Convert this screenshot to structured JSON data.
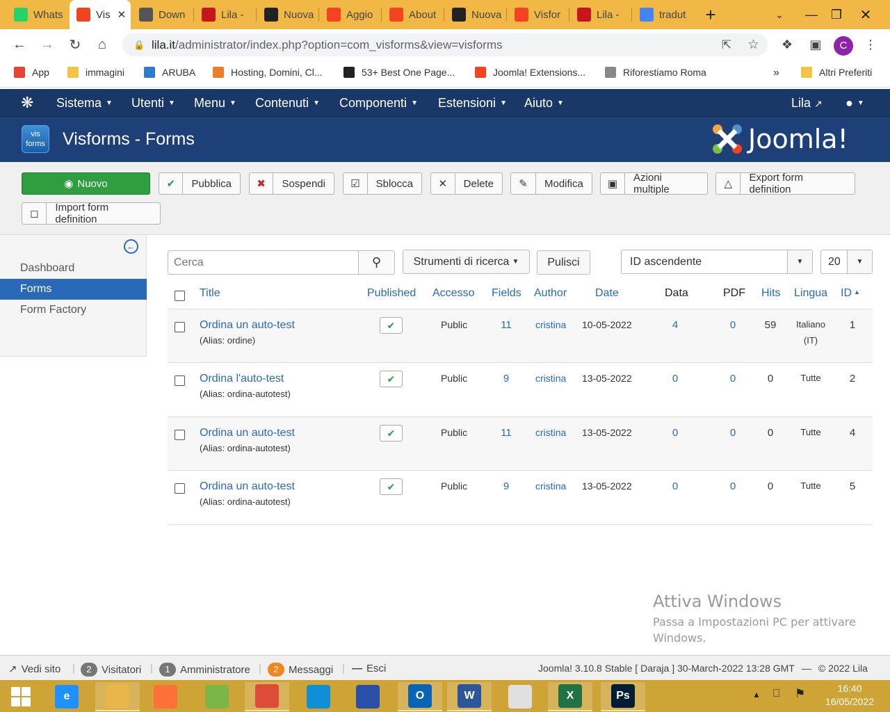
{
  "browser": {
    "tabs": [
      {
        "title": "Whats",
        "icon": "whatsapp-icon",
        "color": "#25d366"
      },
      {
        "title": "Vis",
        "icon": "joomla-icon",
        "color": "#f44321",
        "active": true
      },
      {
        "title": "Down",
        "icon": "download-icon",
        "color": "#555555"
      },
      {
        "title": "Lila -",
        "icon": "lila-icon",
        "color": "#c4161c"
      },
      {
        "title": "Nuova",
        "icon": "github-icon",
        "color": "#222222"
      },
      {
        "title": "Aggio",
        "icon": "joomla-icon",
        "color": "#f44321"
      },
      {
        "title": "About",
        "icon": "joomla-icon",
        "color": "#f44321"
      },
      {
        "title": "Nuova",
        "icon": "github-icon",
        "color": "#222222"
      },
      {
        "title": "Visfor",
        "icon": "joomla-icon",
        "color": "#f44321"
      },
      {
        "title": "Lila -",
        "icon": "lila-icon",
        "color": "#c4161c"
      },
      {
        "title": "tradut",
        "icon": "google-icon",
        "color": "#4285f4"
      }
    ],
    "url_host": "lila.it",
    "url_path": "/administrator/index.php?option=com_visforms&view=visforms",
    "profile_initial": "C",
    "bookmarks": [
      {
        "label": "App",
        "icon": "apps-grid-icon"
      },
      {
        "label": "immagini",
        "icon": "folder-icon"
      },
      {
        "label": "ARUBA",
        "icon": "aruba-icon"
      },
      {
        "label": "Hosting, Domini, Cl...",
        "icon": "hosting-icon"
      },
      {
        "label": "53+ Best One Page...",
        "icon": "joo-icon"
      },
      {
        "label": "Joomla! Extensions...",
        "icon": "joomla-icon"
      },
      {
        "label": "Riforestiamo Roma",
        "icon": "tree-icon"
      }
    ],
    "bookmarks_more": "»",
    "bookmarks_other": "Altri Preferiti"
  },
  "joomla": {
    "menu": [
      "Sistema",
      "Utenti",
      "Menu",
      "Contenuti",
      "Componenti",
      "Estensioni",
      "Aiuto"
    ],
    "user": "Lila",
    "logo_text": "vis forms",
    "page_title": "Visforms - Forms",
    "brand": "Joomla!",
    "toolbar": {
      "new": "Nuovo",
      "publish": "Pubblica",
      "unpublish": "Sospendi",
      "checkin": "Sblocca",
      "delete": "Delete",
      "edit": "Modifica",
      "batch": "Azioni multiple",
      "export": "Export form definition",
      "import": "Import form definition"
    },
    "sidebar": [
      "Dashboard",
      "Forms",
      "Form Factory"
    ],
    "filters": {
      "search_placeholder": "Cerca",
      "search_tools": "Strumenti di ricerca",
      "clear": "Pulisci",
      "ordering": "ID ascendente",
      "limit": "20"
    },
    "columns": [
      "Title",
      "Published",
      "Accesso",
      "Fields",
      "Author",
      "Date",
      "Data",
      "PDF",
      "Hits",
      "Lingua",
      "ID"
    ],
    "rows": [
      {
        "title": "Ordina un auto-test",
        "alias": "(Alias: ordine)",
        "access": "Public",
        "fields": "11",
        "author": "cristina",
        "date": "10-05-2022",
        "data": "4",
        "pdf": "0",
        "hits": "59",
        "language": "Italiano",
        "language2": "(IT)",
        "id": "1"
      },
      {
        "title": "Ordina l'auto-test",
        "alias": "(Alias: ordina-autotest)",
        "access": "Public",
        "fields": "9",
        "author": "cristina",
        "date": "13-05-2022",
        "data": "0",
        "pdf": "0",
        "hits": "0",
        "language": "Tutte",
        "language2": "",
        "id": "2"
      },
      {
        "title": "Ordina un auto-test",
        "alias": "(Alias: ordina-autotest)",
        "access": "Public",
        "fields": "11",
        "author": "cristina",
        "date": "13-05-2022",
        "data": "0",
        "pdf": "0",
        "hits": "0",
        "language": "Tutte",
        "language2": "",
        "id": "4"
      },
      {
        "title": "Ordina un auto-test",
        "alias": "(Alias: ordina-autotest)",
        "access": "Public",
        "fields": "9",
        "author": "cristina",
        "date": "13-05-2022",
        "data": "0",
        "pdf": "0",
        "hits": "0",
        "language": "Tutte",
        "language2": "",
        "id": "5"
      }
    ],
    "status": {
      "view_site": "Vedi sito",
      "visitors_count": "2",
      "visitors": "Visitatori",
      "admin_count": "1",
      "admin": "Amministratore",
      "messages_count": "2",
      "messages": "Messaggi",
      "logout": "Esci",
      "version": "Joomla! 3.10.8 Stable [ Daraja ] 30-March-2022 13:28 GMT",
      "copyright": "© 2022 Lila"
    }
  },
  "watermark": {
    "title": "Attiva Windows",
    "line1": "Passa a Impostazioni PC per attivare",
    "line2": "Windows."
  },
  "taskbar": {
    "time": "16:40",
    "date": "16/05/2022",
    "apps": [
      {
        "name": "internet-explorer-icon",
        "label": "e",
        "color": "#1e90ff"
      },
      {
        "name": "file-explorer-icon",
        "label": "",
        "color": "#e8b64b"
      },
      {
        "name": "firefox-icon",
        "label": "",
        "color": "#ff7139"
      },
      {
        "name": "notepad-icon",
        "label": "",
        "color": "#7ab648"
      },
      {
        "name": "chrome-icon",
        "label": "",
        "color": "#dd4b39"
      },
      {
        "name": "edge-icon",
        "label": "",
        "color": "#0f8fd8"
      },
      {
        "name": "save-disk-icon",
        "label": "",
        "color": "#2a4fa8"
      },
      {
        "name": "outlook-icon",
        "label": "O",
        "color": "#0a64b5"
      },
      {
        "name": "word-icon",
        "label": "W",
        "color": "#2b579a"
      },
      {
        "name": "acrobat-icon",
        "label": "",
        "color": "#e0e0e0"
      },
      {
        "name": "excel-icon",
        "label": "X",
        "color": "#217346"
      },
      {
        "name": "photoshop-icon",
        "label": "Ps",
        "color": "#001e36"
      }
    ]
  }
}
